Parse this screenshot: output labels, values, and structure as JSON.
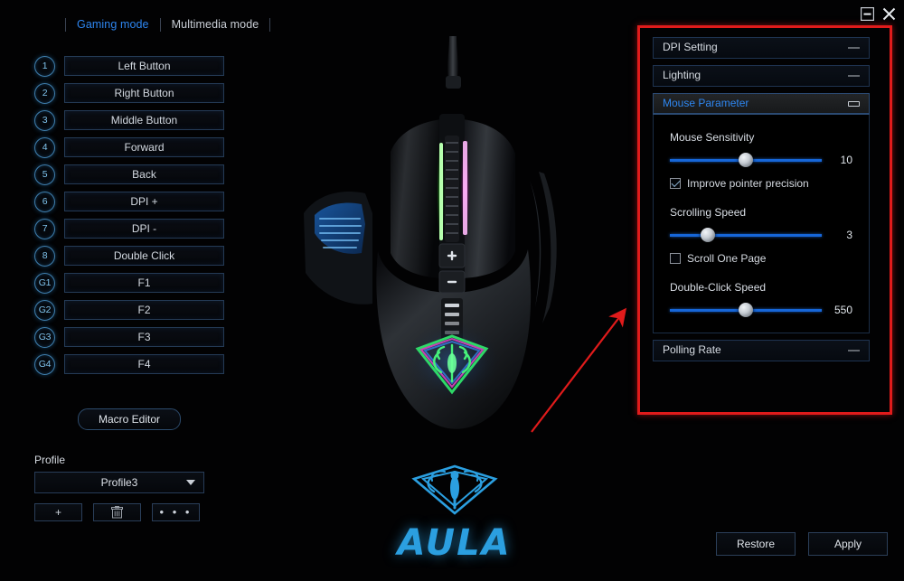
{
  "window": {
    "minimize_icon": "minimize-icon",
    "close_icon": "close-icon"
  },
  "tabs": [
    {
      "label": "Gaming mode",
      "active": true
    },
    {
      "label": "Multimedia mode",
      "active": false
    }
  ],
  "buttons": [
    {
      "num": "1",
      "assignment": "Left Button"
    },
    {
      "num": "2",
      "assignment": "Right Button"
    },
    {
      "num": "3",
      "assignment": "Middle Button"
    },
    {
      "num": "4",
      "assignment": "Forward"
    },
    {
      "num": "5",
      "assignment": "Back"
    },
    {
      "num": "6",
      "assignment": "DPI +"
    },
    {
      "num": "7",
      "assignment": "DPI -"
    },
    {
      "num": "8",
      "assignment": "Double Click"
    },
    {
      "num": "G1",
      "assignment": "F1"
    },
    {
      "num": "G2",
      "assignment": "F2"
    },
    {
      "num": "G3",
      "assignment": "F3"
    },
    {
      "num": "G4",
      "assignment": "F4"
    }
  ],
  "macro": {
    "label": "Macro Editor"
  },
  "profile": {
    "label": "Profile",
    "selected": "Profile3",
    "add_label": "+",
    "delete_icon": "trash-icon",
    "more_label": "• • •"
  },
  "brand": {
    "word": "AULA",
    "logo_icon": "aula-spider-logo"
  },
  "panel": {
    "sections": [
      {
        "title": "DPI Setting",
        "open": false,
        "collapse_icon": "minus-icon"
      },
      {
        "title": "Lighting",
        "open": false,
        "collapse_icon": "minus-icon"
      },
      {
        "title": "Mouse Parameter",
        "open": true,
        "collapse_icon": "restore-icon"
      },
      {
        "title": "Polling Rate",
        "open": false,
        "collapse_icon": "minus-icon"
      }
    ],
    "mouse_parameter": {
      "sensitivity": {
        "label": "Mouse Sensitivity",
        "value": "10",
        "percent": 50
      },
      "improve_precision": {
        "label": "Improve pointer precision",
        "checked": true
      },
      "scrolling": {
        "label": "Scrolling Speed",
        "value": "3",
        "percent": 25
      },
      "scroll_one_page": {
        "label": "Scroll One Page",
        "checked": false
      },
      "double_click": {
        "label": "Double-Click Speed",
        "value": "550",
        "percent": 50
      }
    }
  },
  "footer": {
    "restore_label": "Restore",
    "apply_label": "Apply"
  },
  "annotation": {
    "highlight_color": "#e01b1b",
    "arrow_icon": "red-arrow-pointing-to-panel"
  }
}
